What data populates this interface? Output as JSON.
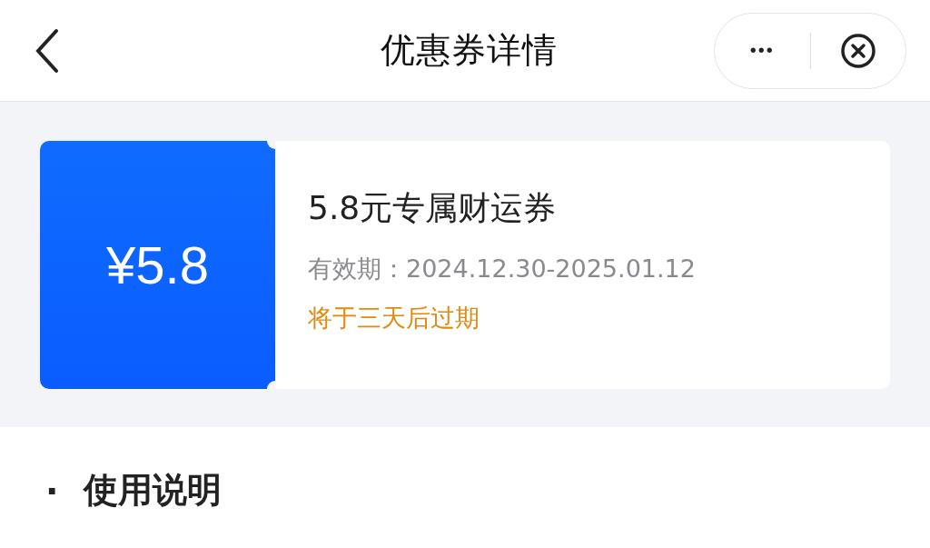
{
  "header": {
    "title": "优惠券详情",
    "more_button": "•••"
  },
  "coupon": {
    "amount": "¥5.8",
    "name": "5.8元专属财运券",
    "validity": "有效期：2024.12.30-2025.01.12",
    "expiry_note": "将于三天后过期"
  },
  "section": {
    "bullet": "·",
    "title": "使用说明"
  }
}
